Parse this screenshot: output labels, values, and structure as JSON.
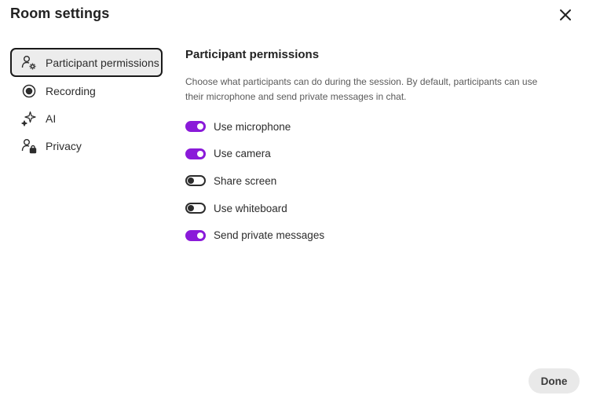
{
  "dialog": {
    "title": "Room settings",
    "close_icon": "close-icon"
  },
  "sidebar": {
    "items": [
      {
        "label": "Participant permissions",
        "icon": "participant-settings-icon",
        "selected": true
      },
      {
        "label": "Recording",
        "icon": "record-icon",
        "selected": false
      },
      {
        "label": "AI",
        "icon": "sparkle-icon",
        "selected": false
      },
      {
        "label": "Privacy",
        "icon": "user-lock-icon",
        "selected": false
      }
    ]
  },
  "main": {
    "title": "Participant permissions",
    "description": "Choose what participants can do during the session. By default, participants can use their microphone and send private messages in chat.",
    "toggles": [
      {
        "label": "Use microphone",
        "on": true
      },
      {
        "label": "Use camera",
        "on": true
      },
      {
        "label": "Share screen",
        "on": false
      },
      {
        "label": "Use whiteboard",
        "on": false
      },
      {
        "label": "Send private messages",
        "on": true
      }
    ]
  },
  "footer": {
    "done_label": "Done"
  },
  "colors": {
    "accent": "#8a1ad9",
    "selected_bg": "#ececec"
  }
}
